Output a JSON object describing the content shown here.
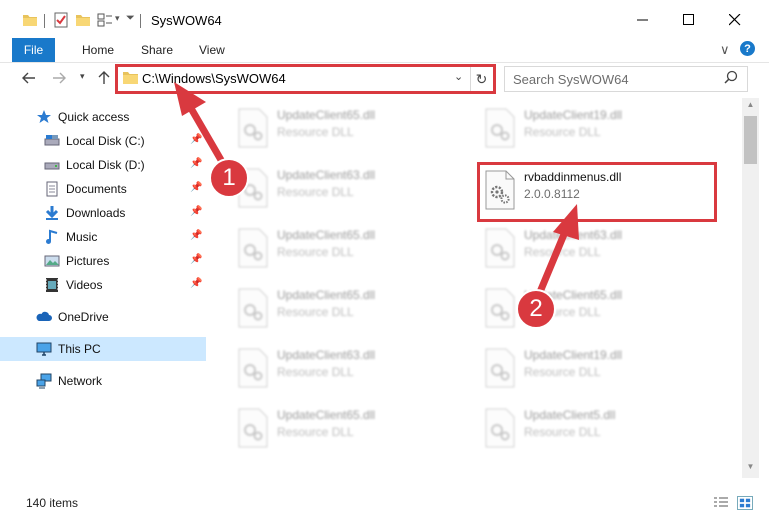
{
  "window": {
    "title": "SysWOW64"
  },
  "ribbon": {
    "file": "File",
    "tabs": [
      "Home",
      "Share",
      "View"
    ],
    "expand_glyph": "∨",
    "help_glyph": "?"
  },
  "nav": {
    "address": "C:\\Windows\\SysWOW64",
    "search_placeholder": "Search SysWOW64"
  },
  "sidebar": {
    "items": [
      {
        "label": "Quick access",
        "icon": "star-icon"
      },
      {
        "label": "Local Disk (C:)",
        "icon": "drive-icon"
      },
      {
        "label": "Local Disk (D:)",
        "icon": "drive-icon"
      },
      {
        "label": "Documents",
        "icon": "documents-icon"
      },
      {
        "label": "Downloads",
        "icon": "downloads-icon"
      },
      {
        "label": "Music",
        "icon": "music-icon"
      },
      {
        "label": "Pictures",
        "icon": "pictures-icon"
      },
      {
        "label": "Videos",
        "icon": "videos-icon"
      },
      {
        "label": "OneDrive",
        "icon": "cloud-icon"
      },
      {
        "label": "This PC",
        "icon": "computer-icon"
      },
      {
        "label": "Network",
        "icon": "network-icon"
      }
    ]
  },
  "files": {
    "left": [
      {
        "name": "UpdateClient65.dll",
        "sub": "Resource DLL"
      },
      {
        "name": "UpdateClient63.dll",
        "sub": "Resource DLL"
      },
      {
        "name": "UpdateClient65.dll",
        "sub": "Resource DLL"
      },
      {
        "name": "UpdateClient65.dll",
        "sub": "Resource DLL"
      },
      {
        "name": "UpdateClient63.dll",
        "sub": "Resource DLL"
      },
      {
        "name": "UpdateClient65.dll",
        "sub": "Resource DLL"
      }
    ],
    "right": [
      {
        "name": "UpdateClient19.dll",
        "sub": "Resource DLL"
      },
      {
        "name": "UpdateClient63.dll",
        "sub": "Resource DLL"
      },
      {
        "name": "UpdateClient65.dll",
        "sub": "Resource DLL"
      },
      {
        "name": "UpdateClient19.dll",
        "sub": "Resource DLL"
      },
      {
        "name": "UpdateClient5.dll",
        "sub": "Resource DLL"
      }
    ],
    "highlighted": {
      "name": "rvbaddinmenus.dll",
      "sub": "2.0.0.8112"
    }
  },
  "status": {
    "item_count": "140 items"
  },
  "annotations": {
    "step1": "1",
    "step2": "2",
    "color": "#d9393f"
  }
}
